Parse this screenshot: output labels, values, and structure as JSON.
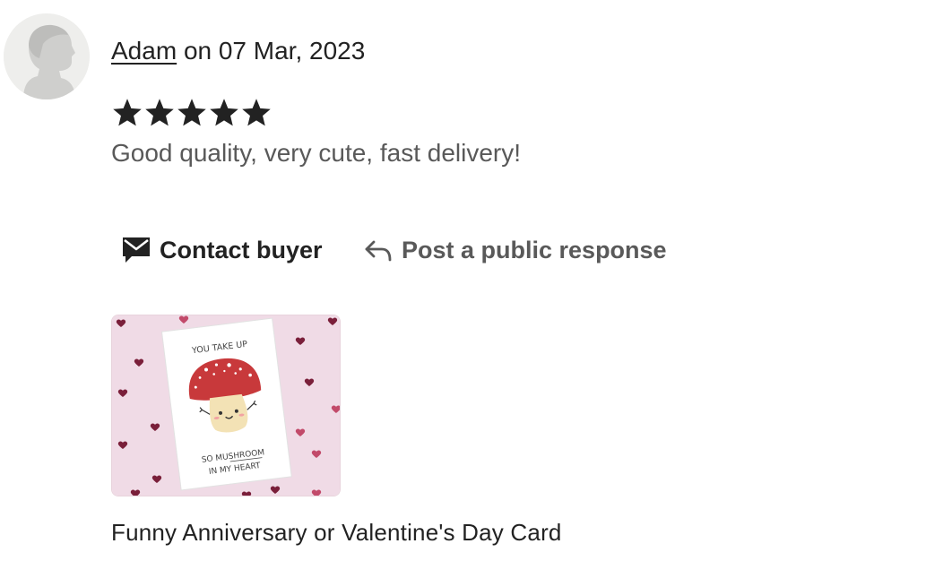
{
  "review": {
    "reviewer_name": "Adam",
    "date_text": "on 07 Mar, 2023",
    "rating": 5,
    "rating_max": 5,
    "text": "Good quality, very cute, fast delivery!"
  },
  "actions": {
    "contact_buyer_label": "Contact buyer",
    "post_response_label": "Post a public response"
  },
  "listing": {
    "title": "Funny Anniversary or Valentine's Day Card",
    "card_text_top": "YOU TAKE UP",
    "card_text_line1": "SO MUSHROOM",
    "card_text_line2": "IN MY HEART"
  },
  "icons": {
    "avatar": "default-avatar-icon",
    "star": "star-icon",
    "contact": "envelope-icon",
    "respond": "reply-arrow-icon"
  },
  "colors": {
    "star": "#222222",
    "card_background": "#f0dbe6",
    "heart": "#7a1f3a",
    "mushroom_cap": "#c8393b"
  }
}
